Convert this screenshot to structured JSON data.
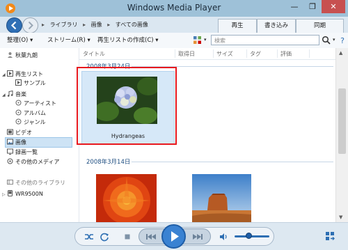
{
  "window": {
    "title": "Windows Media Player",
    "buttons": {
      "minimize": "—",
      "maximize": "❐",
      "close": "✕"
    }
  },
  "nav": {
    "breadcrumbs": [
      "ライブラリ",
      "画像",
      "すべての画像"
    ],
    "tabs": [
      "再生",
      "書き込み",
      "同期"
    ]
  },
  "toolbar": {
    "organize": "整理(O)",
    "stream": "ストリーム(R)",
    "create_playlist": "再生リストの作成(C)",
    "search_placeholder": "検索"
  },
  "sidebar": {
    "user": "秋葉九朗",
    "playlists": "再生リスト",
    "sample": "サンプル",
    "music": "音楽",
    "artist": "アーティスト",
    "album": "アルバム",
    "genre": "ジャンル",
    "video": "ビデオ",
    "images": "画像",
    "recorded_tv": "録画一覧",
    "other_media": "その他のメディア",
    "other_libraries": "その他のライブラリ",
    "device": "WR9500N"
  },
  "columns": [
    "タイトル",
    "取得日",
    "サイズ",
    "タグ",
    "評価"
  ],
  "groups": [
    {
      "date": "2008年3月24日",
      "items": [
        {
          "label": "Hydrangeas",
          "selected": true
        }
      ]
    },
    {
      "date": "2008年3月14日",
      "items": [
        {
          "label": ""
        },
        {
          "label": ""
        }
      ]
    }
  ],
  "player": {
    "volume": 0.4
  },
  "colors": {
    "titlebar": "#9ec1d8",
    "selection": "#d6e8f8",
    "highlight_box": "#e8181e",
    "accent": "#2e6fb3"
  },
  "icons": [
    "app-icon",
    "back-icon",
    "forward-icon",
    "search-icon",
    "help-icon",
    "shuffle-icon",
    "repeat-icon",
    "stop-icon",
    "previous-icon",
    "play-icon",
    "next-icon",
    "volume-icon",
    "switch-view-icon"
  ]
}
